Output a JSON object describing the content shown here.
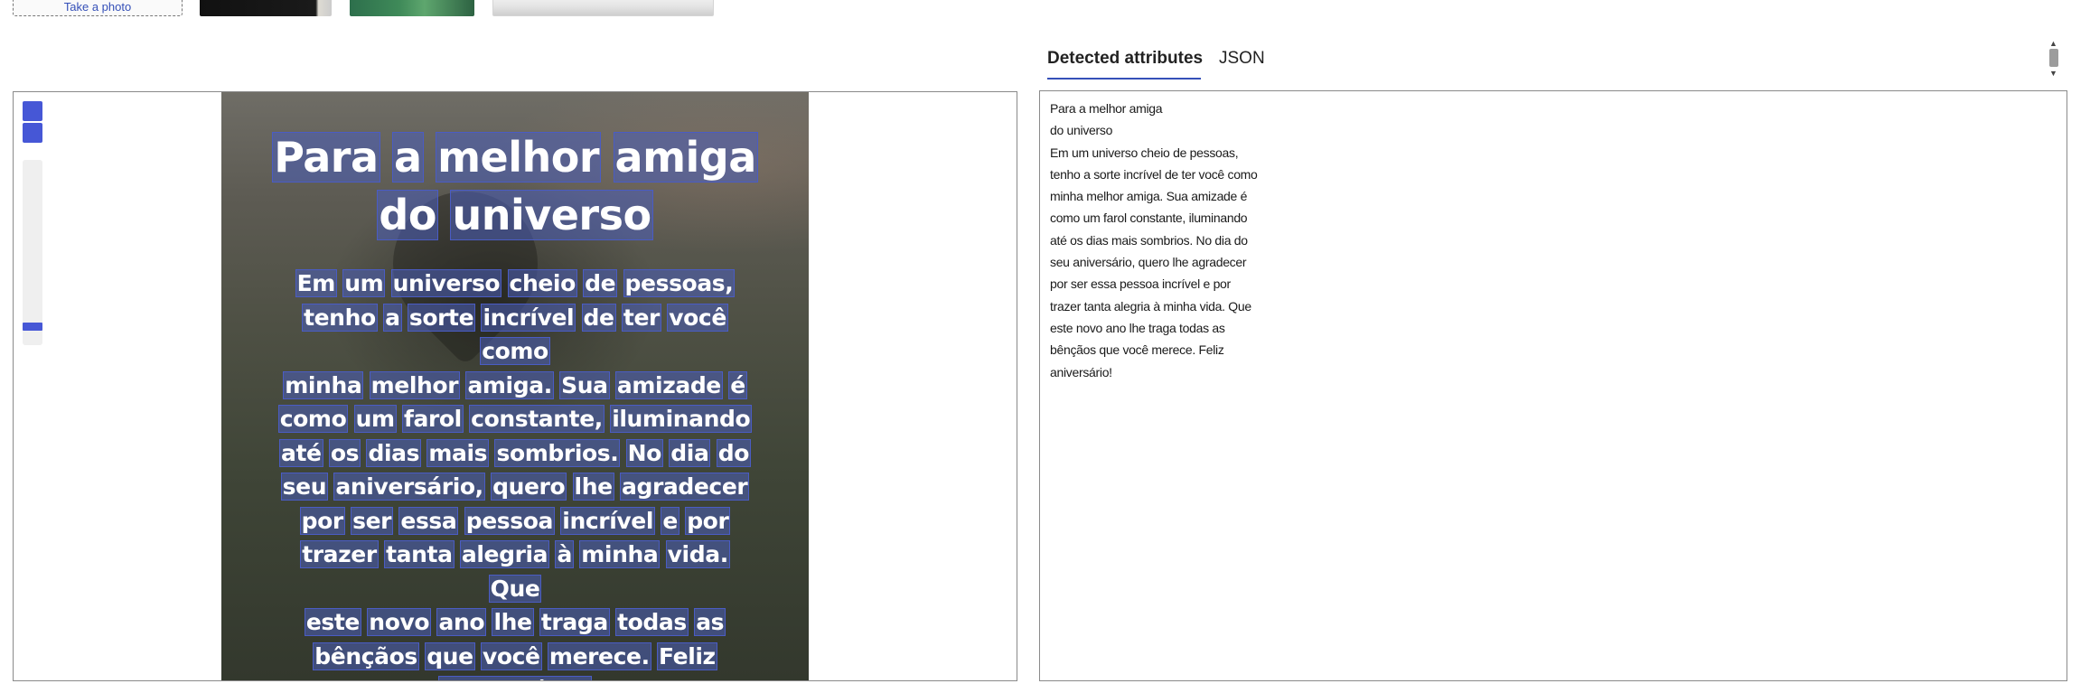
{
  "upload": {
    "take_photo_label": "Take a photo"
  },
  "tabs": [
    {
      "label": "Detected attributes"
    },
    {
      "label": "JSON"
    }
  ],
  "image_text": {
    "title_lines": [
      [
        "Para",
        "a",
        "melhor",
        "amiga"
      ],
      [
        "do",
        "universo"
      ]
    ],
    "body_lines": [
      [
        "Em",
        "um",
        "universo",
        "cheio",
        "de",
        "pessoas,"
      ],
      [
        "tenho",
        "a",
        "sorte",
        "incrível",
        "de",
        "ter",
        "você",
        "como"
      ],
      [
        "minha",
        "melhor",
        "amiga.",
        "Sua",
        "amizade",
        "é"
      ],
      [
        "como",
        "um",
        "farol",
        "constante,",
        "iluminando"
      ],
      [
        "até",
        "os",
        "dias",
        "mais",
        "sombrios.",
        "No",
        "dia",
        "do"
      ],
      [
        "seu",
        "aniversário,",
        "quero",
        "lhe",
        "agradecer"
      ],
      [
        "por",
        "ser",
        "essa",
        "pessoa",
        "incrível",
        "e",
        "por"
      ],
      [
        "trazer",
        "tanta",
        "alegria",
        "à",
        "minha",
        "vida.",
        "Que"
      ],
      [
        "este",
        "novo",
        "ano",
        "lhe",
        "traga",
        "todas",
        "as"
      ],
      [
        "bênçãos",
        "que",
        "você",
        "merece.",
        "Feliz"
      ],
      [
        "aniversário!"
      ]
    ]
  },
  "detected_text": "Para a melhor amiga\ndo universo\nEm um universo cheio de pessoas,\ntenho a sorte incrível de ter você como\nminha melhor amiga. Sua amizade é\ncomo um farol constante, iluminando\naté os dias mais sombrios. No dia do\nseu aniversário, quero lhe agradecer\npor ser essa pessoa incrível e por\ntrazer tanta alegria à minha vida. Que\neste novo ano lhe traga todas as\nbênçãos que você merece. Feliz\naniversário!",
  "colors": {
    "accent": "#4657d6",
    "word_box": "#4a5cc4",
    "tab_underline": "#3550b8"
  }
}
